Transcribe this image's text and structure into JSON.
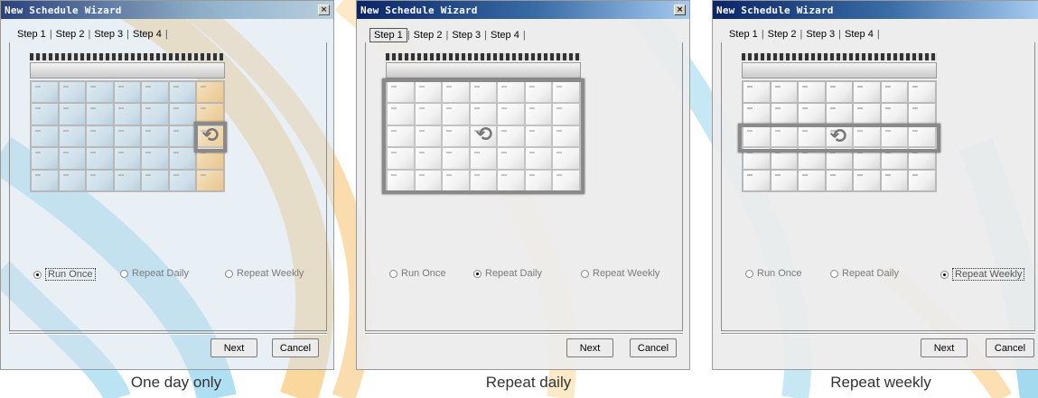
{
  "colors": {
    "accent_orange": "#f0a030",
    "accent_blue": "#1aa3d9",
    "titlebar_blue": "#0a246a"
  },
  "panels": [
    {
      "title": "New Schedule Wizard",
      "tabs": [
        "Step 1",
        "Step 2",
        "Step 3",
        "Step 4"
      ],
      "radios": [
        {
          "label": "Run Once",
          "selected": true
        },
        {
          "label": "Repeat Daily",
          "selected": false
        },
        {
          "label": "Repeat Weekly",
          "selected": false
        }
      ],
      "next_label": "Next",
      "cancel_label": "Cancel",
      "caption": "One day only"
    },
    {
      "title": "New Schedule Wizard",
      "tabs": [
        "Step 1",
        "Step 2",
        "Step 3",
        "Step 4"
      ],
      "radios": [
        {
          "label": "Run Once",
          "selected": false
        },
        {
          "label": "Repeat Daily",
          "selected": true
        },
        {
          "label": "Repeat Weekly",
          "selected": false
        }
      ],
      "next_label": "Next",
      "cancel_label": "Cancel",
      "caption": "Repeat daily"
    },
    {
      "title": "New Schedule Wizard",
      "tabs": [
        "Step 1",
        "Step 2",
        "Step 3",
        "Step 4"
      ],
      "radios": [
        {
          "label": "Run Once",
          "selected": false
        },
        {
          "label": "Repeat Daily",
          "selected": false
        },
        {
          "label": "Repeat Weekly",
          "selected": true
        }
      ],
      "next_label": "Next",
      "cancel_label": "Cancel",
      "caption": "Repeat weekly"
    }
  ],
  "icons": {
    "repeat": "repeat-arrows-icon",
    "close": "close-icon"
  }
}
